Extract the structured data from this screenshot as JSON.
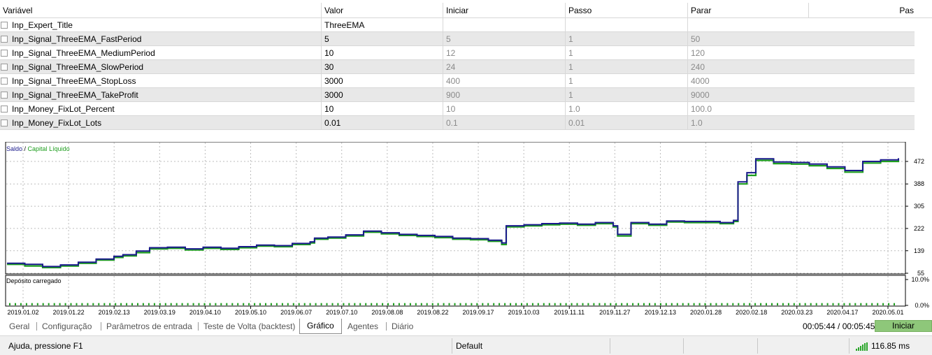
{
  "params": {
    "columns": [
      "Variável",
      "Valor",
      "Iniciar",
      "Passo",
      "Parar",
      "Pas"
    ],
    "rows": [
      {
        "name": "Inp_Expert_Title",
        "value": "ThreeEMA",
        "start": "",
        "step": "",
        "stop": ""
      },
      {
        "name": "Inp_Signal_ThreeEMA_FastPeriod",
        "value": "5",
        "start": "5",
        "step": "1",
        "stop": "50"
      },
      {
        "name": "Inp_Signal_ThreeEMA_MediumPeriod",
        "value": "10",
        "start": "12",
        "step": "1",
        "stop": "120"
      },
      {
        "name": "Inp_Signal_ThreeEMA_SlowPeriod",
        "value": "30",
        "start": "24",
        "step": "1",
        "stop": "240"
      },
      {
        "name": "Inp_Signal_ThreeEMA_StopLoss",
        "value": "3000",
        "start": "400",
        "step": "1",
        "stop": "4000"
      },
      {
        "name": "Inp_Signal_ThreeEMA_TakeProfit",
        "value": "3000",
        "start": "900",
        "step": "1",
        "stop": "9000"
      },
      {
        "name": "Inp_Money_FixLot_Percent",
        "value": "10",
        "start": "10",
        "step": "1.0",
        "stop": "100.0"
      },
      {
        "name": "Inp_Money_FixLot_Lots",
        "value": "0.01",
        "start": "0.1",
        "step": "0.01",
        "stop": "1.0"
      }
    ]
  },
  "chart_data": {
    "type": "line",
    "legend": {
      "balance": "Saldo",
      "separator": " / ",
      "equity": "Capital Líquido"
    },
    "colors": {
      "balance": "#1a1a8c",
      "equity": "#1e9e1e",
      "deposit": "#1e9e1e"
    },
    "y_ticks": [
      "472",
      "388",
      "305",
      "222",
      "139",
      "55"
    ],
    "ylim": [
      55,
      472
    ],
    "x_ticks": [
      "2019.01.02",
      "2019.01.22",
      "2019.02.13",
      "2019.03.19",
      "2019.04.10",
      "2019.05.10",
      "2019.06.07",
      "2019.07.10",
      "2019.08.08",
      "2019.08.22",
      "2019.09.17",
      "2019.10.03",
      "2019.11.11",
      "2019.11.27",
      "2019.12.13",
      "2020.01.28",
      "2020.02.18",
      "2020.03.23",
      "2020.04.17",
      "2020.05.01"
    ],
    "series": [
      {
        "name": "Saldo",
        "values": [
          [
            0.0,
            92
          ],
          [
            0.02,
            88
          ],
          [
            0.04,
            80
          ],
          [
            0.06,
            86
          ],
          [
            0.08,
            96
          ],
          [
            0.1,
            108
          ],
          [
            0.12,
            118
          ],
          [
            0.13,
            124
          ],
          [
            0.145,
            138
          ],
          [
            0.16,
            150
          ],
          [
            0.18,
            152
          ],
          [
            0.2,
            146
          ],
          [
            0.22,
            152
          ],
          [
            0.24,
            148
          ],
          [
            0.26,
            154
          ],
          [
            0.28,
            160
          ],
          [
            0.3,
            158
          ],
          [
            0.32,
            166
          ],
          [
            0.34,
            172
          ],
          [
            0.345,
            186
          ],
          [
            0.36,
            190
          ],
          [
            0.38,
            198
          ],
          [
            0.4,
            212
          ],
          [
            0.42,
            206
          ],
          [
            0.44,
            200
          ],
          [
            0.46,
            196
          ],
          [
            0.48,
            192
          ],
          [
            0.5,
            186
          ],
          [
            0.52,
            184
          ],
          [
            0.54,
            178
          ],
          [
            0.555,
            168
          ],
          [
            0.56,
            232
          ],
          [
            0.58,
            236
          ],
          [
            0.6,
            240
          ],
          [
            0.62,
            242
          ],
          [
            0.64,
            238
          ],
          [
            0.66,
            244
          ],
          [
            0.68,
            232
          ],
          [
            0.685,
            200
          ],
          [
            0.7,
            244
          ],
          [
            0.72,
            238
          ],
          [
            0.74,
            250
          ],
          [
            0.76,
            248
          ],
          [
            0.78,
            248
          ],
          [
            0.8,
            244
          ],
          [
            0.815,
            252
          ],
          [
            0.82,
            396
          ],
          [
            0.83,
            430
          ],
          [
            0.84,
            482
          ],
          [
            0.86,
            470
          ],
          [
            0.88,
            468
          ],
          [
            0.9,
            462
          ],
          [
            0.92,
            452
          ],
          [
            0.94,
            438
          ],
          [
            0.96,
            472
          ],
          [
            0.98,
            478
          ],
          [
            1.0,
            484
          ]
        ]
      },
      {
        "name": "Capital Líquido",
        "values": [
          [
            0.0,
            88
          ],
          [
            0.02,
            82
          ],
          [
            0.04,
            76
          ],
          [
            0.06,
            82
          ],
          [
            0.08,
            92
          ],
          [
            0.1,
            104
          ],
          [
            0.12,
            114
          ],
          [
            0.13,
            120
          ],
          [
            0.145,
            132
          ],
          [
            0.16,
            146
          ],
          [
            0.18,
            148
          ],
          [
            0.2,
            142
          ],
          [
            0.22,
            148
          ],
          [
            0.24,
            144
          ],
          [
            0.26,
            150
          ],
          [
            0.28,
            156
          ],
          [
            0.3,
            154
          ],
          [
            0.32,
            162
          ],
          [
            0.34,
            168
          ],
          [
            0.345,
            182
          ],
          [
            0.36,
            186
          ],
          [
            0.38,
            194
          ],
          [
            0.4,
            208
          ],
          [
            0.42,
            202
          ],
          [
            0.44,
            196
          ],
          [
            0.46,
            192
          ],
          [
            0.48,
            188
          ],
          [
            0.5,
            182
          ],
          [
            0.52,
            180
          ],
          [
            0.54,
            174
          ],
          [
            0.555,
            162
          ],
          [
            0.56,
            228
          ],
          [
            0.58,
            232
          ],
          [
            0.6,
            236
          ],
          [
            0.62,
            238
          ],
          [
            0.64,
            234
          ],
          [
            0.66,
            240
          ],
          [
            0.68,
            228
          ],
          [
            0.685,
            194
          ],
          [
            0.7,
            240
          ],
          [
            0.72,
            234
          ],
          [
            0.74,
            246
          ],
          [
            0.76,
            244
          ],
          [
            0.78,
            244
          ],
          [
            0.8,
            240
          ],
          [
            0.815,
            248
          ],
          [
            0.82,
            388
          ],
          [
            0.83,
            420
          ],
          [
            0.84,
            476
          ],
          [
            0.86,
            464
          ],
          [
            0.88,
            462
          ],
          [
            0.9,
            456
          ],
          [
            0.92,
            446
          ],
          [
            0.94,
            432
          ],
          [
            0.96,
            466
          ],
          [
            0.98,
            472
          ],
          [
            1.0,
            478
          ]
        ]
      }
    ],
    "deposit": {
      "label": "Depósito carregado",
      "y_ticks": [
        "10.0%",
        "0.0%"
      ],
      "ylim": [
        0,
        10
      ],
      "bar_count": 160,
      "bar_value": 0.9
    }
  },
  "tabs": [
    {
      "label": "Geral",
      "active": false
    },
    {
      "label": "Configuração",
      "active": false
    },
    {
      "label": "Parâmetros de entrada",
      "active": false
    },
    {
      "label": "Teste de Volta (backtest)",
      "active": false
    },
    {
      "label": "Gráfico",
      "active": true
    },
    {
      "label": "Agentes",
      "active": false
    },
    {
      "label": "Diário",
      "active": false
    }
  ],
  "timer": "00:05:44 / 00:05:45",
  "start_button": "Iniciar",
  "status": {
    "help": "Ajuda, pressione F1",
    "profile": "Default",
    "ping": "116.85 ms"
  }
}
